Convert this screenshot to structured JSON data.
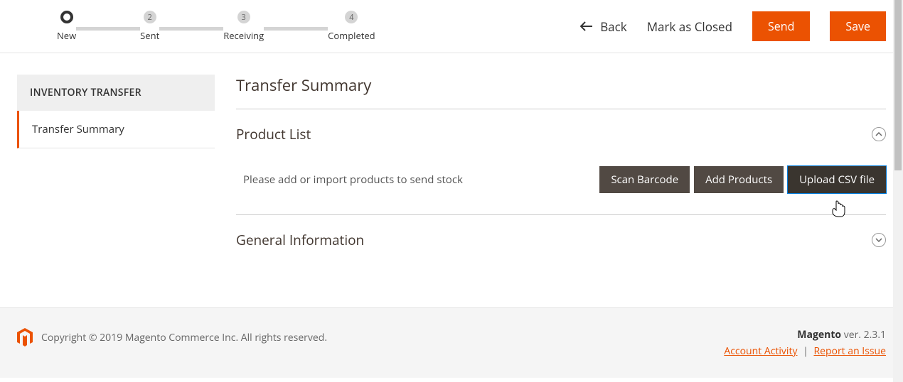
{
  "steps": [
    {
      "num": "",
      "label": "New",
      "active": true
    },
    {
      "num": "2",
      "label": "Sent",
      "active": false
    },
    {
      "num": "3",
      "label": "Receiving",
      "active": false
    },
    {
      "num": "4",
      "label": "Completed",
      "active": false
    }
  ],
  "header": {
    "back": "Back",
    "mark_closed": "Mark as Closed",
    "send": "Send",
    "save": "Save"
  },
  "sidebar": {
    "title": "INVENTORY TRANSFER",
    "items": [
      {
        "label": "Transfer Summary",
        "active": true
      }
    ]
  },
  "main": {
    "title": "Transfer Summary",
    "product_list": {
      "title": "Product List",
      "empty": "Please add or import products to send stock",
      "scan": "Scan Barcode",
      "add": "Add Products",
      "upload": "Upload CSV file"
    },
    "general_info": {
      "title": "General Information"
    }
  },
  "footer": {
    "copyright": "Copyright © 2019 Magento Commerce Inc. All rights reserved.",
    "brand": "Magento",
    "ver_prefix": " ver. ",
    "version": "2.3.1",
    "account_activity": "Account Activity",
    "report_issue": "Report an Issue"
  }
}
